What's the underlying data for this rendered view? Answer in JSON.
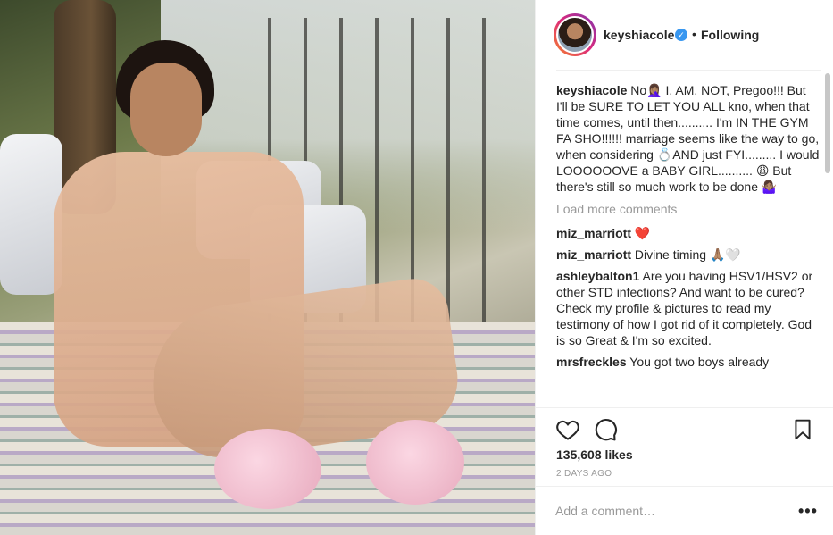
{
  "post": {
    "image_alt": "Photo"
  },
  "header": {
    "username": "keyshiacole",
    "verified_mark": "✓",
    "separator": "•",
    "follow_label": "Following"
  },
  "caption": {
    "user": "keyshiacole",
    "text": "No🤦🏽‍♀️ I, AM, NOT, Pregoo!!! But I'll be SURE TO LET YOU ALL kno, when that time comes, until then.......... I'm IN THE GYM FA SHO!!!!!! marriage seems like the way to go, when considering 💍AND just FYI......... I would LOOOOOOVE a BABY GIRL.......... 😩 But there's still so much work to be done 🤷🏽‍♀️"
  },
  "load_more": "Load more comments",
  "comments": [
    {
      "user": "miz_marriott",
      "text": "❤️"
    },
    {
      "user": "miz_marriott",
      "text": "Divine timing 🙏🏽🤍"
    },
    {
      "user": "ashleybalton1",
      "text": "Are you having HSV1/HSV2 or other STD infections? And want to be cured? Check my profile & pictures to read my testimony of how I got rid of it completely. God is so Great & I'm so excited."
    },
    {
      "user": "mrsfreckles",
      "text": "You got two boys already"
    }
  ],
  "actions": {
    "like_icon": "heart-outline-icon",
    "comment_icon": "comment-bubble-icon",
    "save_icon": "bookmark-icon",
    "likes": "135,608 likes",
    "timestamp": "2 DAYS AGO"
  },
  "add_comment": {
    "placeholder": "Add a comment…",
    "more": "•••"
  },
  "colors": {
    "verified": "#3897f0",
    "muted": "#999999",
    "text": "#262626",
    "heart": "#ed4956"
  }
}
